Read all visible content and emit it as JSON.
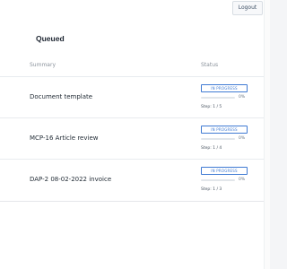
{
  "header": {
    "logout_label": "Logout"
  },
  "section": {
    "title": "Queued"
  },
  "table": {
    "columns": {
      "summary": "Summary",
      "status": "Status"
    },
    "rows": [
      {
        "summary": "Document template",
        "status": "IN PROGRESS",
        "progress_label": "0%",
        "progress_fraction": 0,
        "step": "Step: 1 / 5"
      },
      {
        "summary": "MCP-16 Article review",
        "status": "IN PROGRESS",
        "progress_label": "0%",
        "progress_fraction": 0,
        "step": "Step: 1 / 4"
      },
      {
        "summary": "DAP-2 08-02-2022 invoice",
        "status": "IN PROGRESS",
        "progress_label": "0%",
        "progress_fraction": 0,
        "step": "Step: 1 / 3"
      }
    ]
  },
  "colors": {
    "accent": "#3f7ad3",
    "text": "#1f2933",
    "muted": "#8a929b"
  }
}
